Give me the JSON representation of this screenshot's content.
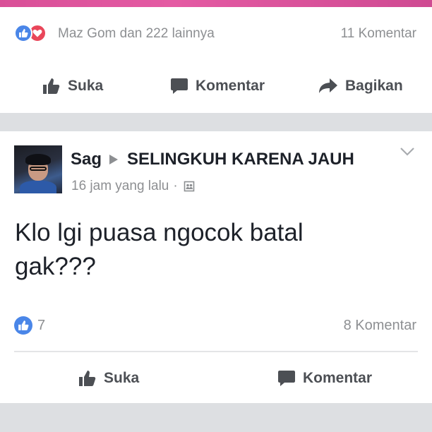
{
  "post1": {
    "reactions_text": "Maz Gom dan 222 lainnya",
    "comments_text": "11 Komentar",
    "actions": {
      "like": "Suka",
      "comment": "Komentar",
      "share": "Bagikan"
    }
  },
  "post2": {
    "author": "Sag",
    "group": "SELINGKUH KARENA JAUH",
    "time": "16 jam yang lalu",
    "separator": "·",
    "body_line1": "Klo lgi puasa ngocok batal",
    "body_line2": "gak???",
    "like_count": "7",
    "comments_text": "8 Komentar",
    "actions": {
      "like": "Suka",
      "comment": "Komentar"
    }
  },
  "icons": {
    "like_reaction": "thumbs-up-icon",
    "love_reaction": "heart-icon",
    "comment": "speech-bubble-icon",
    "share": "share-arrow-icon",
    "audience": "group-icon",
    "menu": "chevron-down-icon"
  },
  "colors": {
    "accent_blue": "#4a86e8",
    "love_red": "#e9465a",
    "text_dark": "#1d2129",
    "text_gray": "#8d8f92",
    "separator_gray": "#dddfe2",
    "banner_pink": "#d94f97"
  }
}
